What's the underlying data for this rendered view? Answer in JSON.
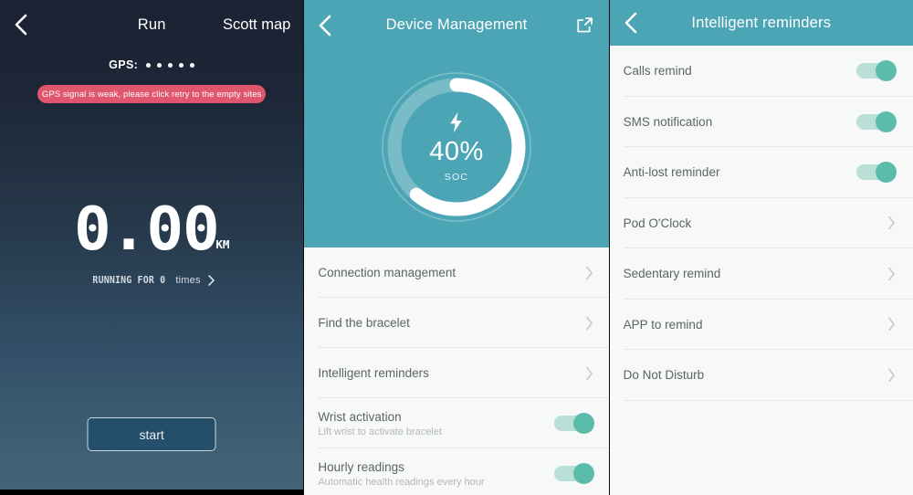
{
  "run_screen": {
    "back_icon": "chevron-left-icon",
    "title": "Run",
    "map_link": "Scott map",
    "gps_label": "GPS:",
    "gps_dots": 5,
    "gps_warning": "GPS signal is weak, please click retry to the empty sites",
    "distance_value": "0.00",
    "distance_unit": "KM",
    "history_prefix": "RUNNING FOR 0",
    "history_suffix": "times",
    "start_button": "start",
    "colors": {
      "bg_top": "#1b2334",
      "bg_bottom": "#426477",
      "warning_pill": "#e0566c",
      "start_border": "#c9d6dd"
    }
  },
  "device_screen": {
    "back_icon": "chevron-left-icon",
    "title": "Device Management",
    "external_link_icon": "external-link-icon",
    "battery": {
      "icon": "lightning-bolt-icon",
      "percent": "40%",
      "percent_value": 40,
      "label": "SOC"
    },
    "colors": {
      "hero": "#4ba5b5",
      "list_bg": "#f7f8f8",
      "toggle_on": "#5cbcac"
    },
    "items": [
      {
        "label": "Connection management",
        "type": "link",
        "chevron": "chevron-right-icon"
      },
      {
        "label": "Find the bracelet",
        "type": "link",
        "chevron": "chevron-right-icon"
      },
      {
        "label": "Intelligent reminders",
        "type": "link",
        "chevron": "chevron-right-icon"
      },
      {
        "label": "Wrist activation",
        "sub": "Lift wrist to activate bracelet",
        "type": "toggle",
        "on": true
      },
      {
        "label": "Hourly readings",
        "sub": "Automatic health readings every hour",
        "type": "toggle",
        "on": true
      }
    ]
  },
  "reminders_screen": {
    "back_icon": "chevron-left-icon",
    "title": "Intelligent reminders",
    "items": [
      {
        "label": "Calls remind",
        "type": "toggle",
        "on": true
      },
      {
        "label": "SMS notification",
        "type": "toggle",
        "on": true
      },
      {
        "label": "Anti-lost reminder",
        "type": "toggle",
        "on": true
      },
      {
        "label": "Pod O'Clock",
        "type": "link",
        "chevron": "chevron-right-icon"
      },
      {
        "label": "Sedentary remind",
        "type": "link",
        "chevron": "chevron-right-icon"
      },
      {
        "label": "APP to remind",
        "type": "link",
        "chevron": "chevron-right-icon"
      },
      {
        "label": "Do Not Disturb",
        "type": "link",
        "chevron": "chevron-right-icon"
      }
    ]
  }
}
